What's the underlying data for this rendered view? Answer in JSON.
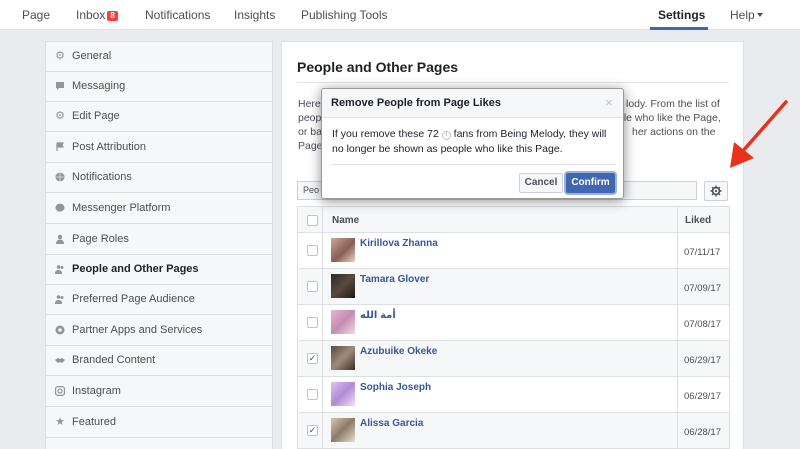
{
  "topnav": {
    "page": "Page",
    "inbox": "Inbox",
    "inbox_badge": "8",
    "notifications": "Notifications",
    "insights": "Insights",
    "publishing_tools": "Publishing Tools",
    "settings": "Settings",
    "help": "Help"
  },
  "sidebar": {
    "items": [
      {
        "label": "General",
        "icon": "gear-icon"
      },
      {
        "label": "Messaging",
        "icon": "chat-icon"
      },
      {
        "label": "Edit Page",
        "icon": "gear-icon"
      },
      {
        "label": "Post Attribution",
        "icon": "flag-icon"
      },
      {
        "label": "Notifications",
        "icon": "globe-icon"
      },
      {
        "label": "Messenger Platform",
        "icon": "messenger-icon"
      },
      {
        "label": "Page Roles",
        "icon": "person-icon"
      },
      {
        "label": "People and Other Pages",
        "icon": "people-icon"
      },
      {
        "label": "Preferred Page Audience",
        "icon": "people-icon"
      },
      {
        "label": "Partner Apps and Services",
        "icon": "apps-icon"
      },
      {
        "label": "Branded Content",
        "icon": "handshake-icon"
      },
      {
        "label": "Instagram",
        "icon": "instagram-icon"
      },
      {
        "label": "Featured",
        "icon": "star-icon"
      }
    ]
  },
  "main": {
    "title": "People and Other Pages",
    "desc_line1_left": "Here'",
    "desc_line1_right": "lody. From the list of",
    "desc_line2_left": "peop",
    "desc_line2_right": "ple who like the Page,",
    "desc_line3_left": "or ba",
    "desc_line3_right": "her actions on the",
    "desc_line4_left": "Page",
    "filter_text": "Peo",
    "columns": {
      "name": "Name",
      "liked": "Liked"
    },
    "rows": [
      {
        "name": "Kirillova Zhanna",
        "date": "07/11/17",
        "checked": false
      },
      {
        "name": "Tamara Glover",
        "date": "07/09/17",
        "checked": false
      },
      {
        "name": "أمة الله",
        "date": "07/08/17",
        "checked": false
      },
      {
        "name": "Azubuike Okeke",
        "date": "06/29/17",
        "checked": true
      },
      {
        "name": "Sophia Joseph",
        "date": "06/29/17",
        "checked": false
      },
      {
        "name": "Alissa Garcia",
        "date": "06/28/17",
        "checked": true
      }
    ]
  },
  "dialog": {
    "title": "Remove People from Page Likes",
    "close": "×",
    "body_part1": "If you remove these 72",
    "body_part2": "fans from Being Melody, they will no longer be shown as people who like this Page.",
    "cancel": "Cancel",
    "confirm": "Confirm"
  },
  "colors": {
    "accent": "#4267b2",
    "link": "#365899",
    "badge": "#fa3e3e",
    "arrow": "#e8321d"
  }
}
